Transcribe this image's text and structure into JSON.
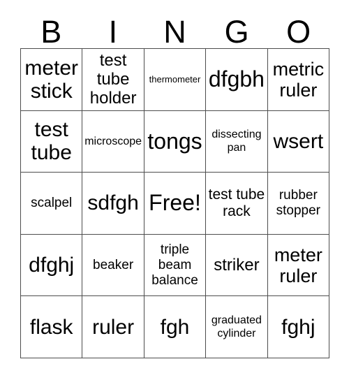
{
  "header": {
    "letters": [
      "B",
      "I",
      "N",
      "G",
      "O"
    ]
  },
  "grid": {
    "rows": [
      [
        {
          "text": "meter stick",
          "size": "fs-xxl"
        },
        {
          "text": "test tube holder",
          "size": "fs-l"
        },
        {
          "text": "thermometer",
          "size": "fs-xs"
        },
        {
          "text": "dfgbh",
          "size": "fs-3xl"
        },
        {
          "text": "metric ruler",
          "size": "fs-xl"
        }
      ],
      [
        {
          "text": "test tube",
          "size": "fs-xxl"
        },
        {
          "text": "microscope",
          "size": "fs-s"
        },
        {
          "text": "tongs",
          "size": "fs-3xl"
        },
        {
          "text": "dissecting pan",
          "size": "fs-s"
        },
        {
          "text": "wsert",
          "size": "fs-xxl"
        }
      ],
      [
        {
          "text": "scalpel",
          "size": "fs-m"
        },
        {
          "text": "sdfgh",
          "size": "fs-xxl"
        },
        {
          "text": "Free!",
          "size": "fs-3xl"
        },
        {
          "text": "test tube rack",
          "size": "fs-ml"
        },
        {
          "text": "rubber stopper",
          "size": "fs-m"
        }
      ],
      [
        {
          "text": "dfghj",
          "size": "fs-xxl"
        },
        {
          "text": "beaker",
          "size": "fs-m"
        },
        {
          "text": "triple beam balance",
          "size": "fs-m"
        },
        {
          "text": "striker",
          "size": "fs-l"
        },
        {
          "text": "meter ruler",
          "size": "fs-xl"
        }
      ],
      [
        {
          "text": "flask",
          "size": "fs-xxl"
        },
        {
          "text": "ruler",
          "size": "fs-xxl"
        },
        {
          "text": "fgh",
          "size": "fs-xxl"
        },
        {
          "text": "graduated cylinder",
          "size": "fs-s"
        },
        {
          "text": "fghj",
          "size": "fs-xxl"
        }
      ]
    ]
  },
  "colors": {
    "border": "#4d4d4d",
    "text": "#000000",
    "background": "#ffffff"
  }
}
